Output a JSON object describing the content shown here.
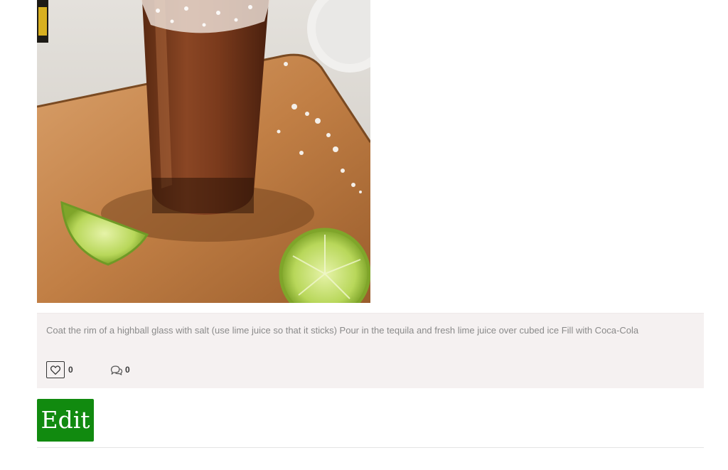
{
  "photo": {
    "alt": "Highball glass with salted rim filled with dark cola drink on a wooden board with lime wedges"
  },
  "post": {
    "description": "Coat the rim of a highball glass with salt (use lime juice so that it sticks) Pour in the tequila and fresh lime juice over cubed ice Fill with Coca-Cola",
    "likes": "0",
    "comments": "0"
  },
  "actions": {
    "edit_label": "Edit"
  },
  "colors": {
    "edit_button": "#118a0f",
    "card_background": "#f5f1f1",
    "description_text": "#8a8a8a"
  },
  "icons": {
    "like": "heart-icon",
    "comment": "comments-icon"
  }
}
